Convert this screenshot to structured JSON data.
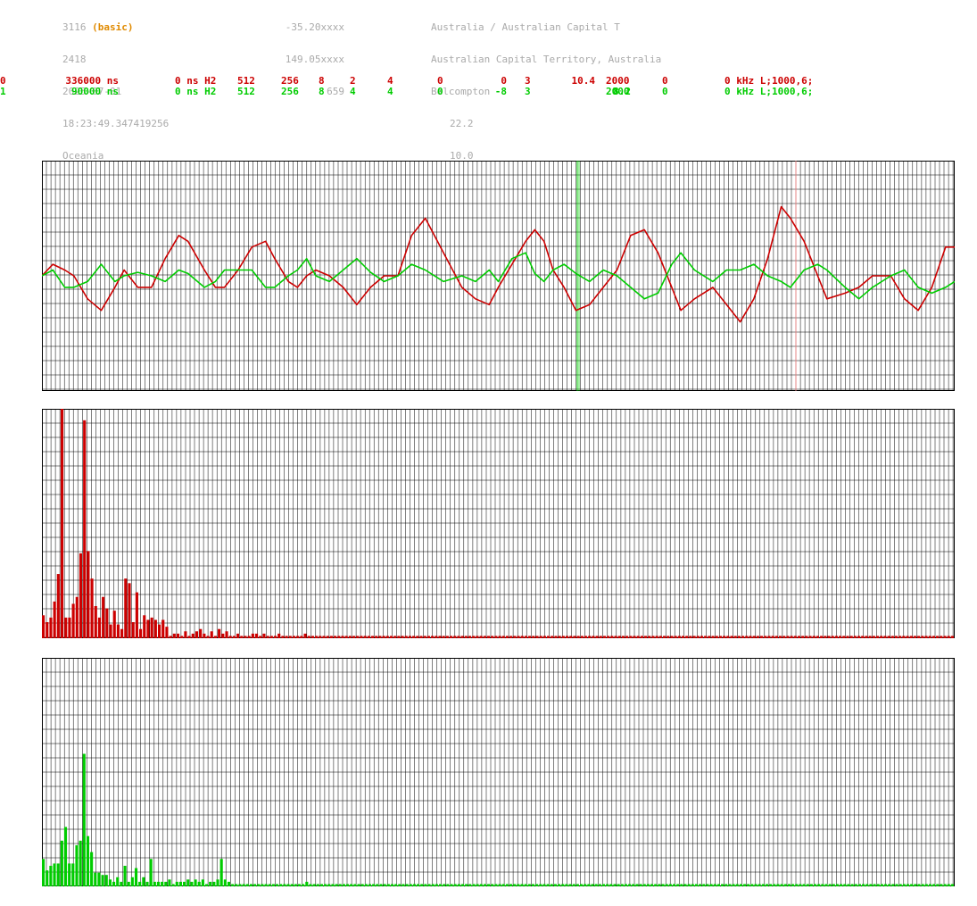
{
  "header": {
    "col1": {
      "id": "3116",
      "badge": "(basic)",
      "line2": "2418",
      "date": "2025-07-01",
      "time": "18:23:49.347419256",
      "region": "Oceania"
    },
    "col2": {
      "lat": "-35.20xxxx",
      "lon": "149.05xxxx",
      "alt": "659"
    },
    "col3": {
      "location": "Australia / Australian Capital T",
      "region": "Australian Capital Territory, Australia",
      "city": "Belcompton",
      "v1": "22.2",
      "v2": "10.0"
    }
  },
  "channels": [
    {
      "index": "0",
      "period": "336000 ns",
      "offset": "0 ns H2",
      "c1": "512",
      "c2": "256",
      "c3": "8",
      "c4": "2",
      "c5": "4",
      "c6": "0",
      "c7": "0",
      "c8": "3",
      "c9": "10.4",
      "c10": "2000",
      "c11": "0",
      "tail": "0 kHz L;1000,6;",
      "color": "#cc0000"
    },
    {
      "index": "1",
      "period": "90000 ns",
      "offset": "0 ns H2",
      "c1": "512",
      "c2": "256",
      "c3": "8",
      "c4": "4",
      "c5": "4",
      "c6": "0",
      "c7": "-8",
      "c8": "3",
      "c9": "8.2",
      "c10": "2000",
      "c11": "0",
      "tail": "0 kHz L;1000,6;",
      "color": "#00cc00"
    }
  ],
  "chart_data": [
    {
      "type": "line",
      "grid": true,
      "ylim": [
        -10,
        10
      ],
      "x": [
        0,
        0.012,
        0.025,
        0.035,
        0.05,
        0.065,
        0.08,
        0.09,
        0.105,
        0.12,
        0.135,
        0.15,
        0.16,
        0.178,
        0.19,
        0.2,
        0.215,
        0.23,
        0.245,
        0.255,
        0.27,
        0.28,
        0.29,
        0.3,
        0.315,
        0.33,
        0.345,
        0.36,
        0.375,
        0.39,
        0.405,
        0.42,
        0.44,
        0.46,
        0.475,
        0.49,
        0.5,
        0.515,
        0.53,
        0.54,
        0.55,
        0.56,
        0.572,
        0.585,
        0.6,
        0.615,
        0.63,
        0.645,
        0.66,
        0.675,
        0.69,
        0.7,
        0.715,
        0.735,
        0.75,
        0.765,
        0.78,
        0.795,
        0.81,
        0.82,
        0.835,
        0.85,
        0.86,
        0.88,
        0.895,
        0.91,
        0.93,
        0.945,
        0.96,
        0.975,
        0.99,
        1.0
      ],
      "series": [
        {
          "color": "#cc0000",
          "values": [
            0,
            1,
            0.5,
            0,
            -2,
            -3,
            -1,
            0.5,
            -1,
            -1,
            1.5,
            3.5,
            3,
            0.5,
            -1,
            -1,
            0.5,
            2.5,
            3,
            1.5,
            -0.5,
            -1,
            0,
            0.5,
            0,
            -1,
            -2.5,
            -1,
            0,
            0,
            3.5,
            5,
            2,
            -1,
            -2,
            -2.5,
            -1,
            1,
            3,
            4,
            3,
            0.5,
            -1,
            -3,
            -2.5,
            -1,
            0.5,
            3.5,
            4,
            2,
            -1,
            -3,
            -2,
            -1,
            -2.5,
            -4,
            -2,
            1.5,
            6,
            5,
            3,
            0,
            -2,
            -1.5,
            -1,
            0,
            0,
            -2,
            -3,
            -1,
            2.5,
            2.5
          ]
        },
        {
          "color": "#00cc00",
          "values": [
            0,
            0.5,
            -1,
            -1,
            -0.5,
            1,
            -0.5,
            0,
            0.3,
            0,
            -0.5,
            0.5,
            0.2,
            -1,
            -0.5,
            0.5,
            0.5,
            0.5,
            -1,
            -1,
            0,
            0.5,
            1.5,
            0,
            -0.5,
            0.5,
            1.5,
            0.3,
            -0.5,
            0,
            1,
            0.5,
            -0.5,
            0,
            -0.5,
            0.5,
            -0.5,
            1.5,
            2,
            0.2,
            -0.5,
            0.5,
            1,
            0.2,
            -0.5,
            0.5,
            0,
            -1,
            -2,
            -1.5,
            1,
            2,
            0.5,
            -0.5,
            0.5,
            0.5,
            1,
            0,
            -0.5,
            -1,
            0.5,
            1,
            0.5,
            -1,
            -2,
            -1,
            0,
            0.5,
            -1,
            -1.5,
            -1,
            -0.5
          ]
        }
      ]
    },
    {
      "type": "bar",
      "grid": true,
      "ylim": [
        0,
        100
      ],
      "series": [
        {
          "color": "#cc0000",
          "values": [
            10,
            7,
            9,
            16,
            28,
            100,
            9,
            9,
            15,
            18,
            37,
            95,
            38,
            26,
            14,
            9,
            18,
            13,
            6,
            12,
            6,
            4,
            26,
            24,
            7,
            20,
            4,
            10,
            8,
            9,
            8,
            6,
            8,
            5,
            1,
            2,
            2,
            1,
            3,
            1,
            2,
            3,
            4,
            2,
            1,
            3,
            1,
            4,
            2,
            3,
            1,
            1,
            2,
            1,
            1,
            1,
            2,
            2,
            1,
            2,
            1,
            1,
            1,
            2,
            1,
            1,
            1,
            1,
            1,
            1,
            2,
            1,
            1,
            1,
            1,
            1,
            1,
            1,
            1,
            1,
            1,
            1,
            1,
            1,
            1,
            1,
            1,
            1,
            1,
            1,
            1,
            1,
            1,
            1,
            1,
            1,
            1,
            1,
            1,
            1,
            1,
            1,
            1,
            1,
            1,
            1,
            1,
            1,
            1,
            1,
            1,
            1,
            1,
            1,
            1,
            1,
            1,
            1,
            1,
            1,
            1,
            1,
            1,
            1,
            1,
            1,
            1,
            1,
            1,
            1,
            1,
            1,
            1,
            1,
            1,
            1,
            1,
            1,
            1,
            1,
            1,
            1,
            1,
            1,
            1,
            1,
            1,
            1,
            1,
            1,
            1,
            1,
            1,
            1,
            1,
            1,
            1,
            1,
            1,
            1,
            1,
            1,
            1,
            1,
            1,
            1,
            1,
            1,
            1,
            1,
            1,
            1,
            1,
            1,
            1,
            1,
            1,
            1,
            1,
            1,
            1,
            1,
            1,
            1,
            1,
            1,
            1,
            1,
            1,
            1,
            1,
            1,
            1,
            1,
            1,
            1,
            1,
            1,
            1,
            1,
            1,
            1,
            1,
            1,
            1,
            1,
            1,
            1,
            1,
            1,
            1,
            1,
            1,
            1,
            1,
            1,
            1,
            1,
            1,
            1,
            1,
            1,
            1,
            1,
            1,
            1,
            1,
            1,
            1,
            1,
            1,
            1,
            1,
            1,
            1,
            1,
            1,
            1,
            1,
            1,
            1,
            1,
            1,
            1
          ]
        }
      ]
    },
    {
      "type": "bar",
      "grid": true,
      "ylim": [
        0,
        100
      ],
      "series": [
        {
          "color": "#00cc00",
          "values": [
            12,
            7,
            9,
            10,
            10,
            20,
            26,
            10,
            10,
            18,
            20,
            58,
            22,
            15,
            6,
            6,
            5,
            5,
            3,
            2,
            4,
            2,
            9,
            2,
            4,
            8,
            2,
            4,
            2,
            12,
            2,
            2,
            2,
            2,
            3,
            1,
            2,
            2,
            2,
            3,
            2,
            3,
            2,
            3,
            1,
            2,
            2,
            3,
            12,
            3,
            2,
            1,
            1,
            1,
            1,
            1,
            1,
            1,
            1,
            1,
            1,
            1,
            1,
            1,
            1,
            1,
            1,
            1,
            1,
            1,
            1,
            2,
            1,
            1,
            1,
            1,
            1,
            1,
            1,
            1,
            1,
            1,
            1,
            1,
            1,
            1,
            1,
            1,
            1,
            1,
            1,
            1,
            1,
            1,
            1,
            1,
            1,
            1,
            1,
            1,
            1,
            1,
            1,
            1,
            1,
            1,
            1,
            1,
            1,
            1,
            1,
            1,
            1,
            1,
            1,
            1,
            1,
            1,
            1,
            1,
            1,
            1,
            1,
            1,
            1,
            1,
            1,
            1,
            1,
            1,
            1,
            1,
            1,
            1,
            1,
            1,
            1,
            1,
            1,
            1,
            1,
            1,
            1,
            1,
            1,
            1,
            1,
            1,
            1,
            1,
            1,
            1,
            1,
            1,
            1,
            1,
            1,
            1,
            1,
            1,
            1,
            1,
            1,
            1,
            1,
            1,
            1,
            1,
            1,
            1,
            1,
            1,
            1,
            1,
            1,
            1,
            1,
            1,
            1,
            1,
            1,
            1,
            1,
            1,
            1,
            1,
            1,
            1,
            1,
            1,
            1,
            1,
            1,
            1,
            1,
            1,
            1,
            1,
            1,
            1,
            1,
            1,
            1,
            1,
            1,
            1,
            1,
            1,
            1,
            1,
            1,
            1,
            1,
            1,
            1,
            1,
            1,
            1,
            1,
            1,
            1,
            1,
            1,
            1,
            1,
            1,
            1,
            1,
            1,
            1,
            1,
            1,
            1,
            1,
            1,
            1,
            1,
            1,
            1,
            1,
            1,
            1,
            1,
            1,
            1,
            1
          ]
        }
      ]
    }
  ]
}
